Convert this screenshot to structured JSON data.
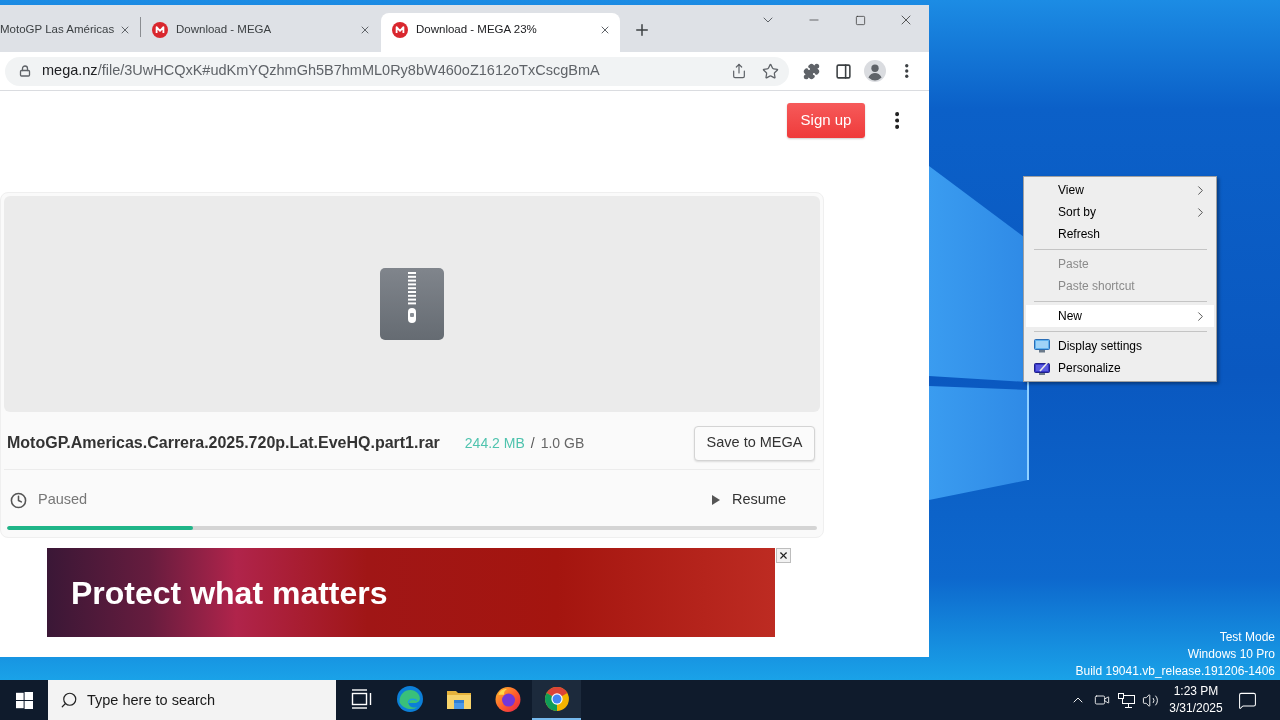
{
  "browser": {
    "tabs": [
      {
        "title": "MotoGP Las Américas",
        "favicon": false,
        "selected": false
      },
      {
        "title": "Download - MEGA",
        "favicon": true,
        "selected": false
      },
      {
        "title": "Download - MEGA 23%",
        "favicon": true,
        "selected": true
      }
    ],
    "address_bar": {
      "host": "mega.nz",
      "path": "/file/3UwHCQxK#udKmYQzhmGh5B7hmML0Ry8bW460oZ1612oTxCscgBmA"
    }
  },
  "page": {
    "signup_button": "Sign up",
    "file": {
      "name": "MotoGP.Americas.Carrera.2025.720p.Lat.EveHQ.part1.rar",
      "downloaded": "244.2 MB",
      "separator": "/",
      "total": "1.0 GB",
      "save_button": "Save to MEGA"
    },
    "transfer": {
      "status": "Paused",
      "action": "Resume",
      "level": 0.23
    },
    "ad": {
      "headline": "Protect what matters"
    }
  },
  "context_menu": {
    "items": [
      {
        "label": "View",
        "kind": "submenu",
        "disabled": false,
        "selected": false
      },
      {
        "label": "Sort by",
        "kind": "submenu",
        "disabled": false,
        "selected": false
      },
      {
        "label": "Refresh",
        "kind": "command",
        "disabled": false,
        "selected": false
      },
      {
        "kind": "separator"
      },
      {
        "label": "Paste",
        "kind": "command",
        "disabled": true,
        "selected": false
      },
      {
        "label": "Paste shortcut",
        "kind": "command",
        "disabled": true,
        "selected": false
      },
      {
        "kind": "separator"
      },
      {
        "label": "New",
        "kind": "submenu",
        "disabled": false,
        "selected": true
      },
      {
        "kind": "separator"
      },
      {
        "label": "Display settings",
        "kind": "display",
        "disabled": false,
        "selected": false
      },
      {
        "label": "Personalize",
        "kind": "personalize",
        "disabled": false,
        "selected": false
      }
    ]
  },
  "desktop_notice": [
    "Test Mode",
    "Windows 10 Pro",
    "Build 19041.vb_release.191206-1406"
  ],
  "taskbar": {
    "search": {
      "placeholder": "Type here to search"
    },
    "apps": [
      {
        "kind": "task-view",
        "active": false
      },
      {
        "kind": "edge",
        "active": false
      },
      {
        "kind": "explorer",
        "active": false
      },
      {
        "kind": "firefox",
        "active": false
      },
      {
        "kind": "chrome",
        "active": true
      }
    ],
    "clock": {
      "time": "1:23 PM",
      "date": "3/31/2025"
    }
  }
}
